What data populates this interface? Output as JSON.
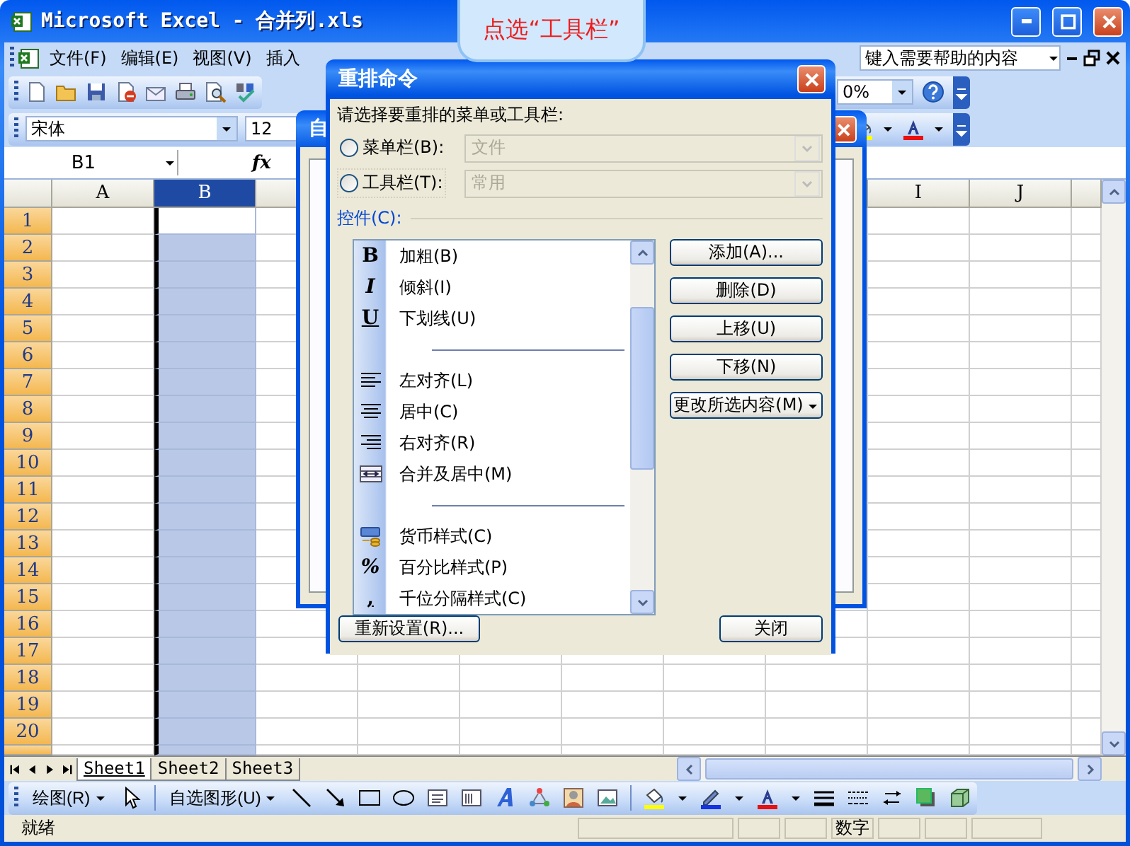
{
  "window": {
    "title": "Microsoft Excel - 合并列.xls"
  },
  "callout": {
    "text": "点选“工具栏”"
  },
  "menu_bar": {
    "items": [
      "文件(F)",
      "编辑(E)",
      "视图(V)",
      "插入"
    ],
    "help_box": {
      "placeholder": "键入需要帮助的内容"
    }
  },
  "standard_toolbar": {
    "zoom": "0%"
  },
  "formatting_toolbar": {
    "font": "宋体",
    "font_size": "12"
  },
  "formula_bar": {
    "name_box": "B1",
    "function_label": "fx"
  },
  "sheet": {
    "left_columns": [
      {
        "label": "A",
        "selected": false
      },
      {
        "label": "B",
        "selected": true
      }
    ],
    "right_columns": [
      {
        "label": "I",
        "selected": false
      },
      {
        "label": "J",
        "selected": false
      }
    ],
    "rows": [
      "1",
      "2",
      "3",
      "4",
      "5",
      "6",
      "7",
      "8",
      "9",
      "10",
      "11",
      "12",
      "13",
      "14",
      "15",
      "16",
      "17",
      "18",
      "19",
      "20"
    ]
  },
  "sheet_tabs": [
    {
      "label": "Sheet1",
      "selected": true
    },
    {
      "label": "Sheet2",
      "selected": false
    },
    {
      "label": "Sheet3",
      "selected": false
    }
  ],
  "drawing_toolbar": {
    "draw_menu": "绘图(R)",
    "autoshapes_menu": "自选图形(U)"
  },
  "status_bar": {
    "status": "就绪",
    "indicators": [
      "数字"
    ]
  },
  "back_dialog": {
    "title": "自"
  },
  "dialog": {
    "title": "重排命令",
    "prompt": "请选择要重排的菜单或工具栏:",
    "options": [
      {
        "label": "菜单栏(B):",
        "selected": false,
        "focused": false,
        "value": "文件",
        "disabled": true
      },
      {
        "label": "工具栏(T):",
        "selected": false,
        "focused": true,
        "value": "常用",
        "disabled": true
      }
    ],
    "controls_label": "控件(C):",
    "commands": [
      {
        "kind": "glyph",
        "glyph": "B",
        "label": "加粗(B)"
      },
      {
        "kind": "glyph",
        "glyph": "I",
        "label": "倾斜(I)"
      },
      {
        "kind": "glyph",
        "glyph": "U",
        "label": "下划线(U)"
      },
      {
        "kind": "separator"
      },
      {
        "kind": "icon",
        "label": "左对齐(L)"
      },
      {
        "kind": "icon",
        "label": "居中(C)"
      },
      {
        "kind": "icon",
        "label": "右对齐(R)"
      },
      {
        "kind": "icon",
        "label": "合并及居中(M)"
      },
      {
        "kind": "separator"
      },
      {
        "kind": "icon",
        "label": "货币样式(C)"
      },
      {
        "kind": "glyph",
        "glyph": "%",
        "label": "百分比样式(P)"
      },
      {
        "kind": "glyph",
        "glyph": ",",
        "label": "千位分隔样式(C)"
      }
    ],
    "side_buttons": [
      {
        "kind": "button",
        "label": "添加(A)..."
      },
      {
        "kind": "button",
        "label": "删除(D)"
      },
      {
        "kind": "button",
        "label": "上移(U)"
      },
      {
        "kind": "button",
        "label": "下移(N)"
      },
      {
        "kind": "menu",
        "label": "更改所选内容(M)"
      }
    ],
    "reset_button": "重新设置(R)...",
    "close_button": "关闭"
  }
}
